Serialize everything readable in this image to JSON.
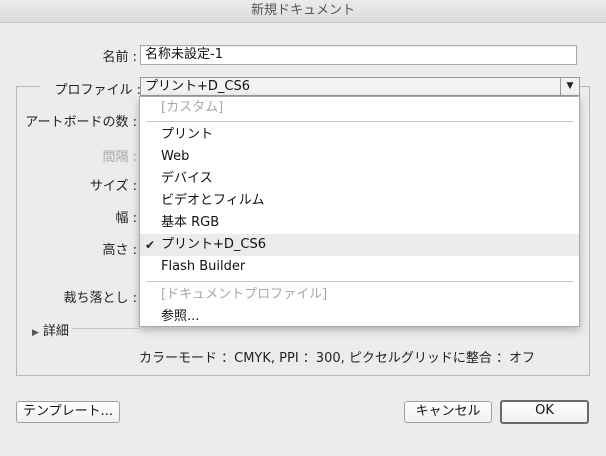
{
  "window": {
    "title": "新規ドキュメント"
  },
  "fields": {
    "name_label": "名前 :",
    "name_value": "名称未設定-1",
    "profile_label": "プロファイル :",
    "profile_value": "プリント+D_CS6",
    "artboards_label": "アートボードの数 :",
    "spacing_label": "間隔 :",
    "size_label": "サイズ :",
    "width_label": "幅 :",
    "height_label": "高さ :",
    "bleed_label": "裁ち落とし :"
  },
  "profile_dropdown": {
    "options": [
      {
        "label": "[カスタム]",
        "disabled": true
      },
      {
        "label": "プリント"
      },
      {
        "label": "Web"
      },
      {
        "label": "デバイス"
      },
      {
        "label": "ビデオとフィルム"
      },
      {
        "label": "基本 RGB"
      },
      {
        "label": "プリント+D_CS6",
        "selected": true,
        "check": "✔"
      },
      {
        "label": "Flash Builder"
      },
      {
        "label": "[ドキュメントプロファイル]",
        "disabled": true
      },
      {
        "label": "参照..."
      }
    ]
  },
  "details": {
    "label": "詳細"
  },
  "summary": "カラーモード ：CMYK, PPI ：300, ピクセルグリッドに整合 ：オフ",
  "buttons": {
    "templates": "テンプレート...",
    "cancel": "キャンセル",
    "ok": "OK"
  },
  "icons": {
    "dropdown_arrow": "chevron-down-icon",
    "details_toggle": "disclosure-triangle-icon",
    "check": "checkmark-icon"
  }
}
